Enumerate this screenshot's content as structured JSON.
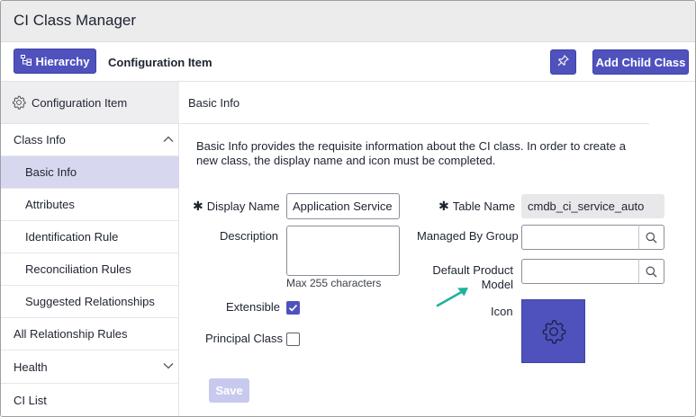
{
  "window": {
    "title": "CI Class Manager"
  },
  "toolbar": {
    "hierarchy_label": "Hierarchy",
    "breadcrumb": "Configuration Item",
    "add_child_label": "Add Child Class"
  },
  "sidebar": {
    "header": "Configuration Item",
    "items": [
      {
        "label": "Class Info",
        "level": "top",
        "expandable": true,
        "expanded": true
      },
      {
        "label": "Basic Info",
        "level": "sub",
        "active": true
      },
      {
        "label": "Attributes",
        "level": "sub"
      },
      {
        "label": "Identification Rule",
        "level": "sub"
      },
      {
        "label": "Reconciliation Rules",
        "level": "sub"
      },
      {
        "label": "Suggested Relationships",
        "level": "sub"
      },
      {
        "label": "All Relationship Rules",
        "level": "top"
      },
      {
        "label": "Health",
        "level": "top",
        "expandable": true,
        "expanded": false
      },
      {
        "label": "CI List",
        "level": "top"
      }
    ]
  },
  "main": {
    "section_title": "Basic Info",
    "description": "Basic Info provides the requisite information about the CI class. In order to create a new class, the display name and icon must be completed.",
    "form": {
      "display_name_label": "Display Name",
      "display_name_value": "Application Service",
      "description_label": "Description",
      "description_hint": "Max 255 characters",
      "extensible_label": "Extensible",
      "extensible_checked": true,
      "principal_class_label": "Principal Class",
      "principal_class_checked": false,
      "table_name_label": "Table Name",
      "table_name_value": "cmdb_ci_service_auto",
      "managed_by_group_label": "Managed By Group",
      "default_product_label_line1": "Default Product",
      "default_product_label_line2": "Model",
      "icon_label": "Icon",
      "icon_name": "gear-icon",
      "save_label": "Save"
    }
  },
  "colors": {
    "accent": "#4f52bd",
    "active_row": "#d7d8ef",
    "annotation_arrow": "#1eb39a"
  }
}
